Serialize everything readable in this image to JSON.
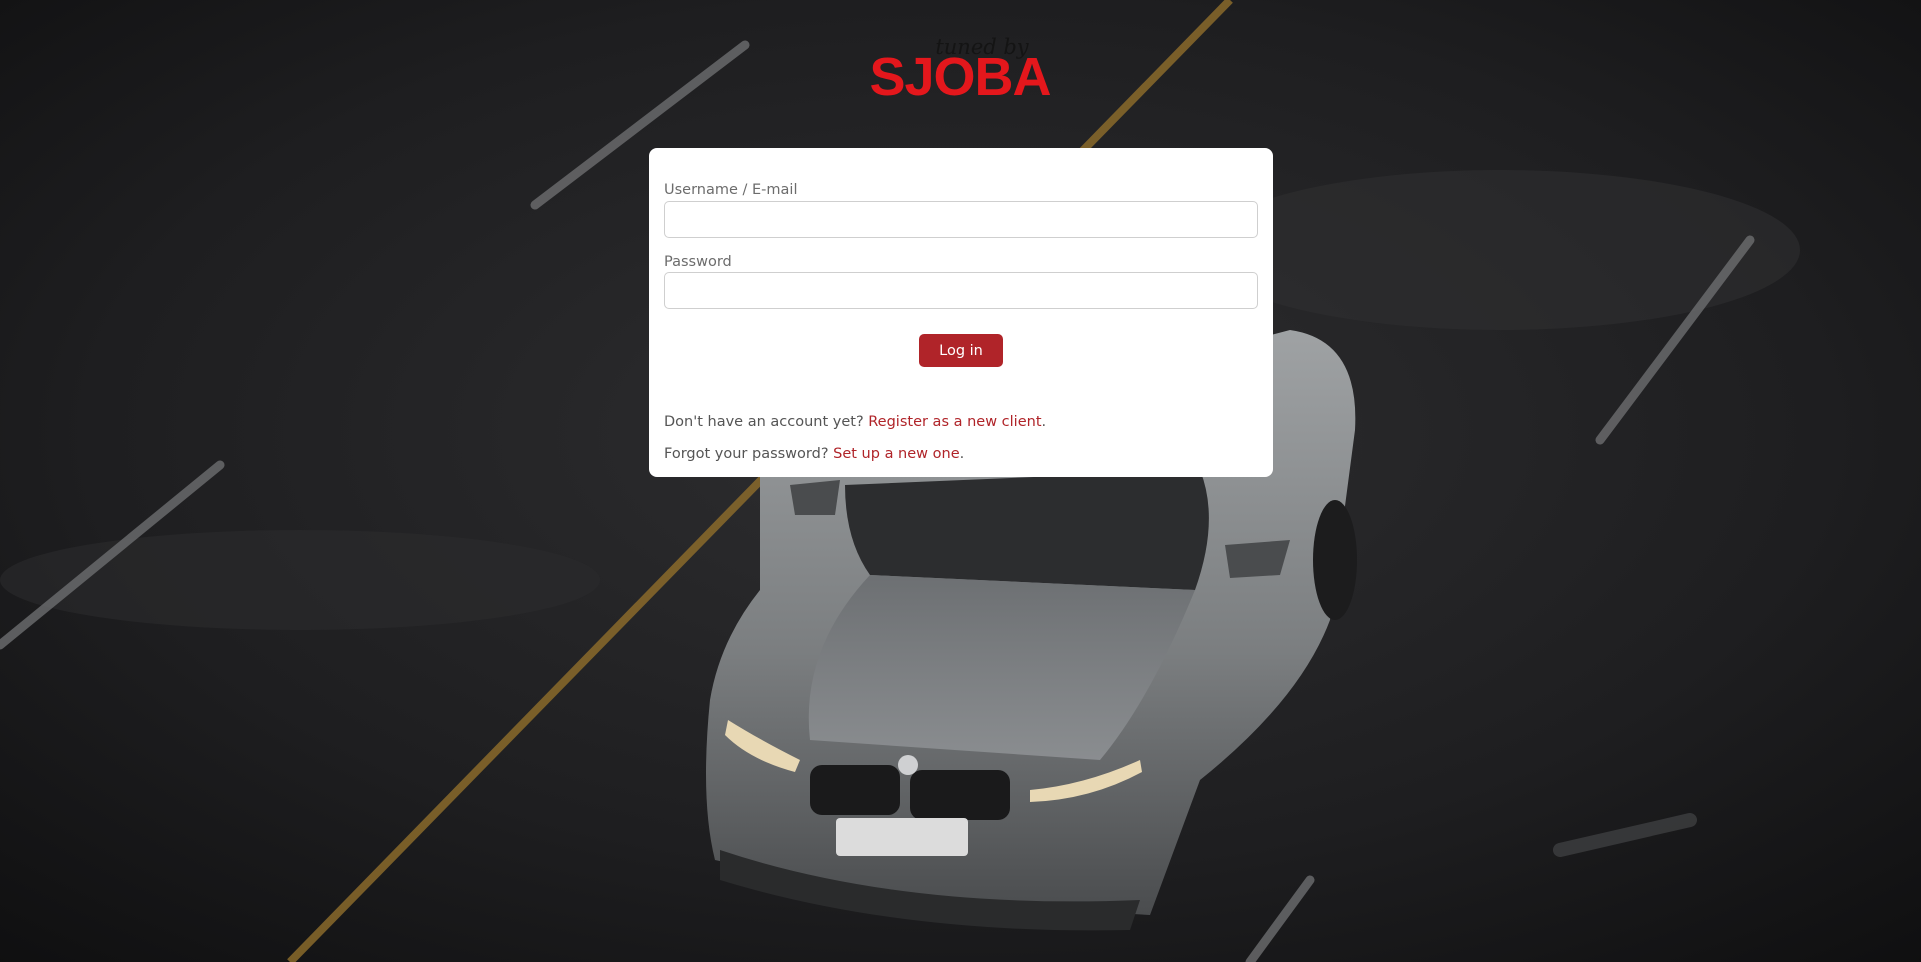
{
  "logo": {
    "script_text": "tuned by",
    "brand_text": "SJOBA",
    "brand_color": "#e4171c"
  },
  "login_form": {
    "username_label": "Username / E-mail",
    "username_value": "",
    "password_label": "Password",
    "password_value": "",
    "login_button_label": "Log in"
  },
  "register_prompt": {
    "text": "Don't have an account yet?",
    "link_text": "Register as a new client",
    "suffix": "."
  },
  "forgot_prompt": {
    "text": "Forgot your password?",
    "link_text": "Set up a new one",
    "suffix": "."
  },
  "colors": {
    "accent": "#b02429",
    "background": "#1f1f20",
    "card": "#ffffff"
  }
}
